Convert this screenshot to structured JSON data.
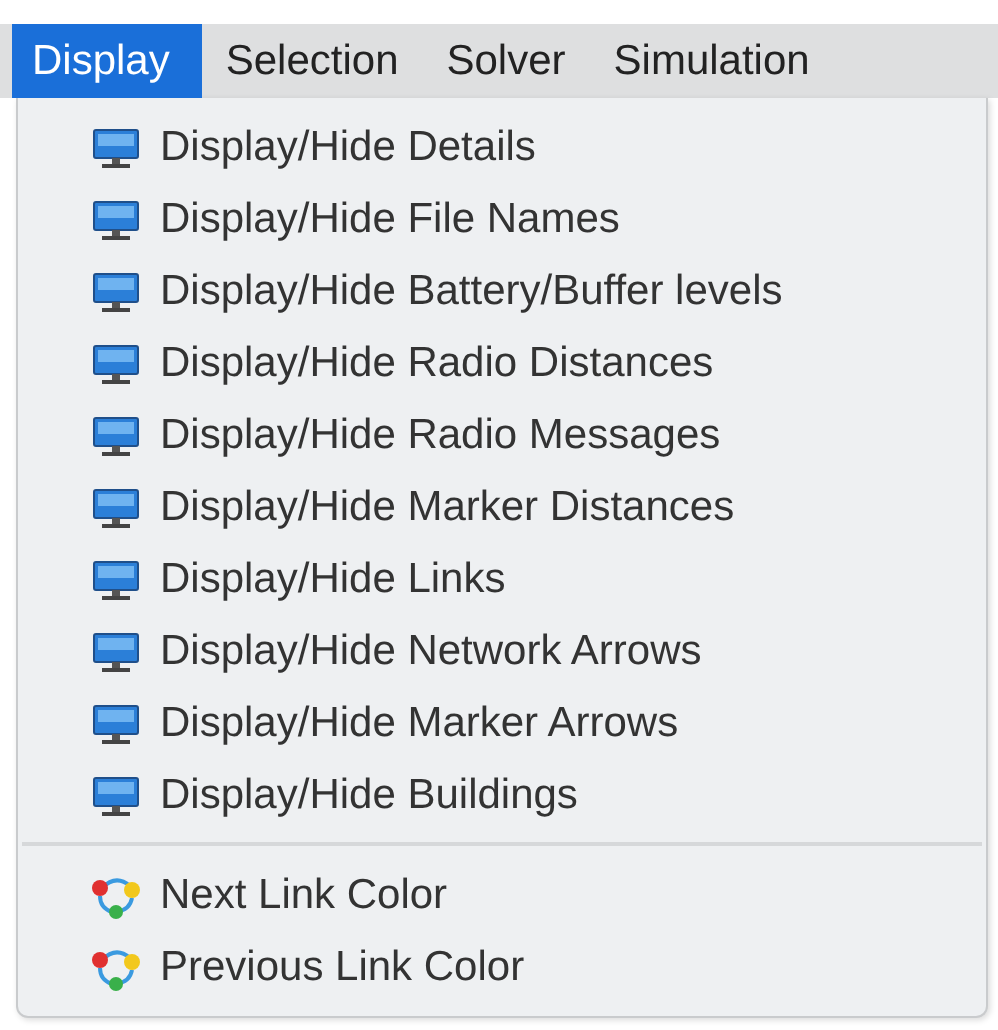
{
  "menubar": [
    {
      "label": "Display",
      "selected": true
    },
    {
      "label": "Selection",
      "selected": false
    },
    {
      "label": "Solver",
      "selected": false
    },
    {
      "label": "Simulation",
      "selected": false
    }
  ],
  "menu": {
    "groups": [
      {
        "items": [
          {
            "label": "Display/Hide Details",
            "kind": "monitor"
          },
          {
            "label": "Display/Hide File Names",
            "kind": "monitor"
          },
          {
            "label": "Display/Hide Battery/Buffer levels",
            "kind": "monitor"
          },
          {
            "label": "Display/Hide Radio Distances",
            "kind": "monitor"
          },
          {
            "label": "Display/Hide Radio Messages",
            "kind": "monitor"
          },
          {
            "label": "Display/Hide Marker Distances",
            "kind": "monitor"
          },
          {
            "label": "Display/Hide Links",
            "kind": "monitor"
          },
          {
            "label": "Display/Hide Network Arrows",
            "kind": "monitor"
          },
          {
            "label": "Display/Hide Marker Arrows",
            "kind": "monitor"
          },
          {
            "label": "Display/Hide Buildings",
            "kind": "monitor"
          }
        ]
      },
      {
        "items": [
          {
            "label": "Next Link Color",
            "kind": "cycle"
          },
          {
            "label": "Previous Link Color",
            "kind": "cycle"
          }
        ]
      }
    ]
  }
}
